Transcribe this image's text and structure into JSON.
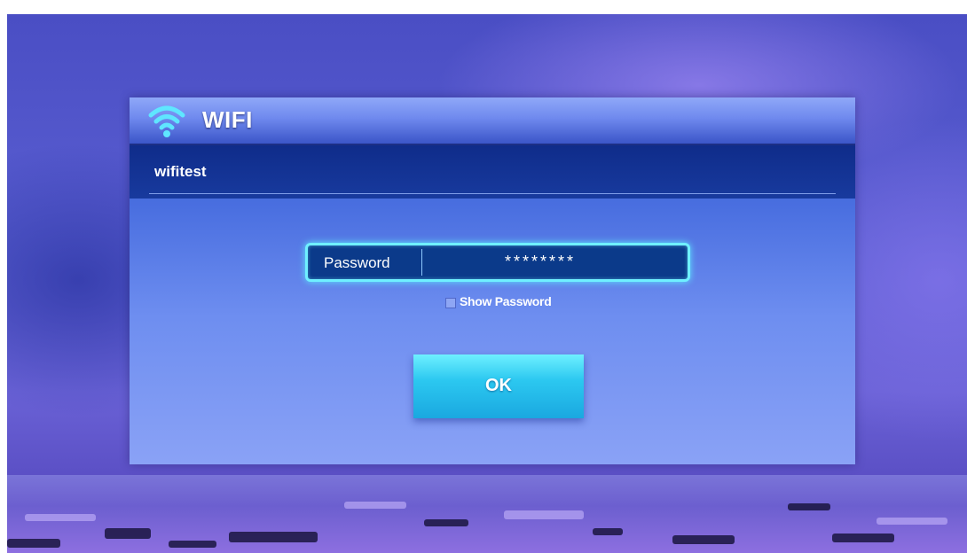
{
  "dialog": {
    "title": "WIFI",
    "title_icon": "wifi-icon",
    "network_name": "wifitest",
    "password_field": {
      "label": "Password",
      "value": "********"
    },
    "show_password": {
      "label": "Show Password",
      "checked": false
    },
    "ok_label": "OK"
  },
  "colors": {
    "focus_glow": "#6ff0ff",
    "ok_button": "#2cc8f0",
    "icon": "#5fe6ff"
  }
}
